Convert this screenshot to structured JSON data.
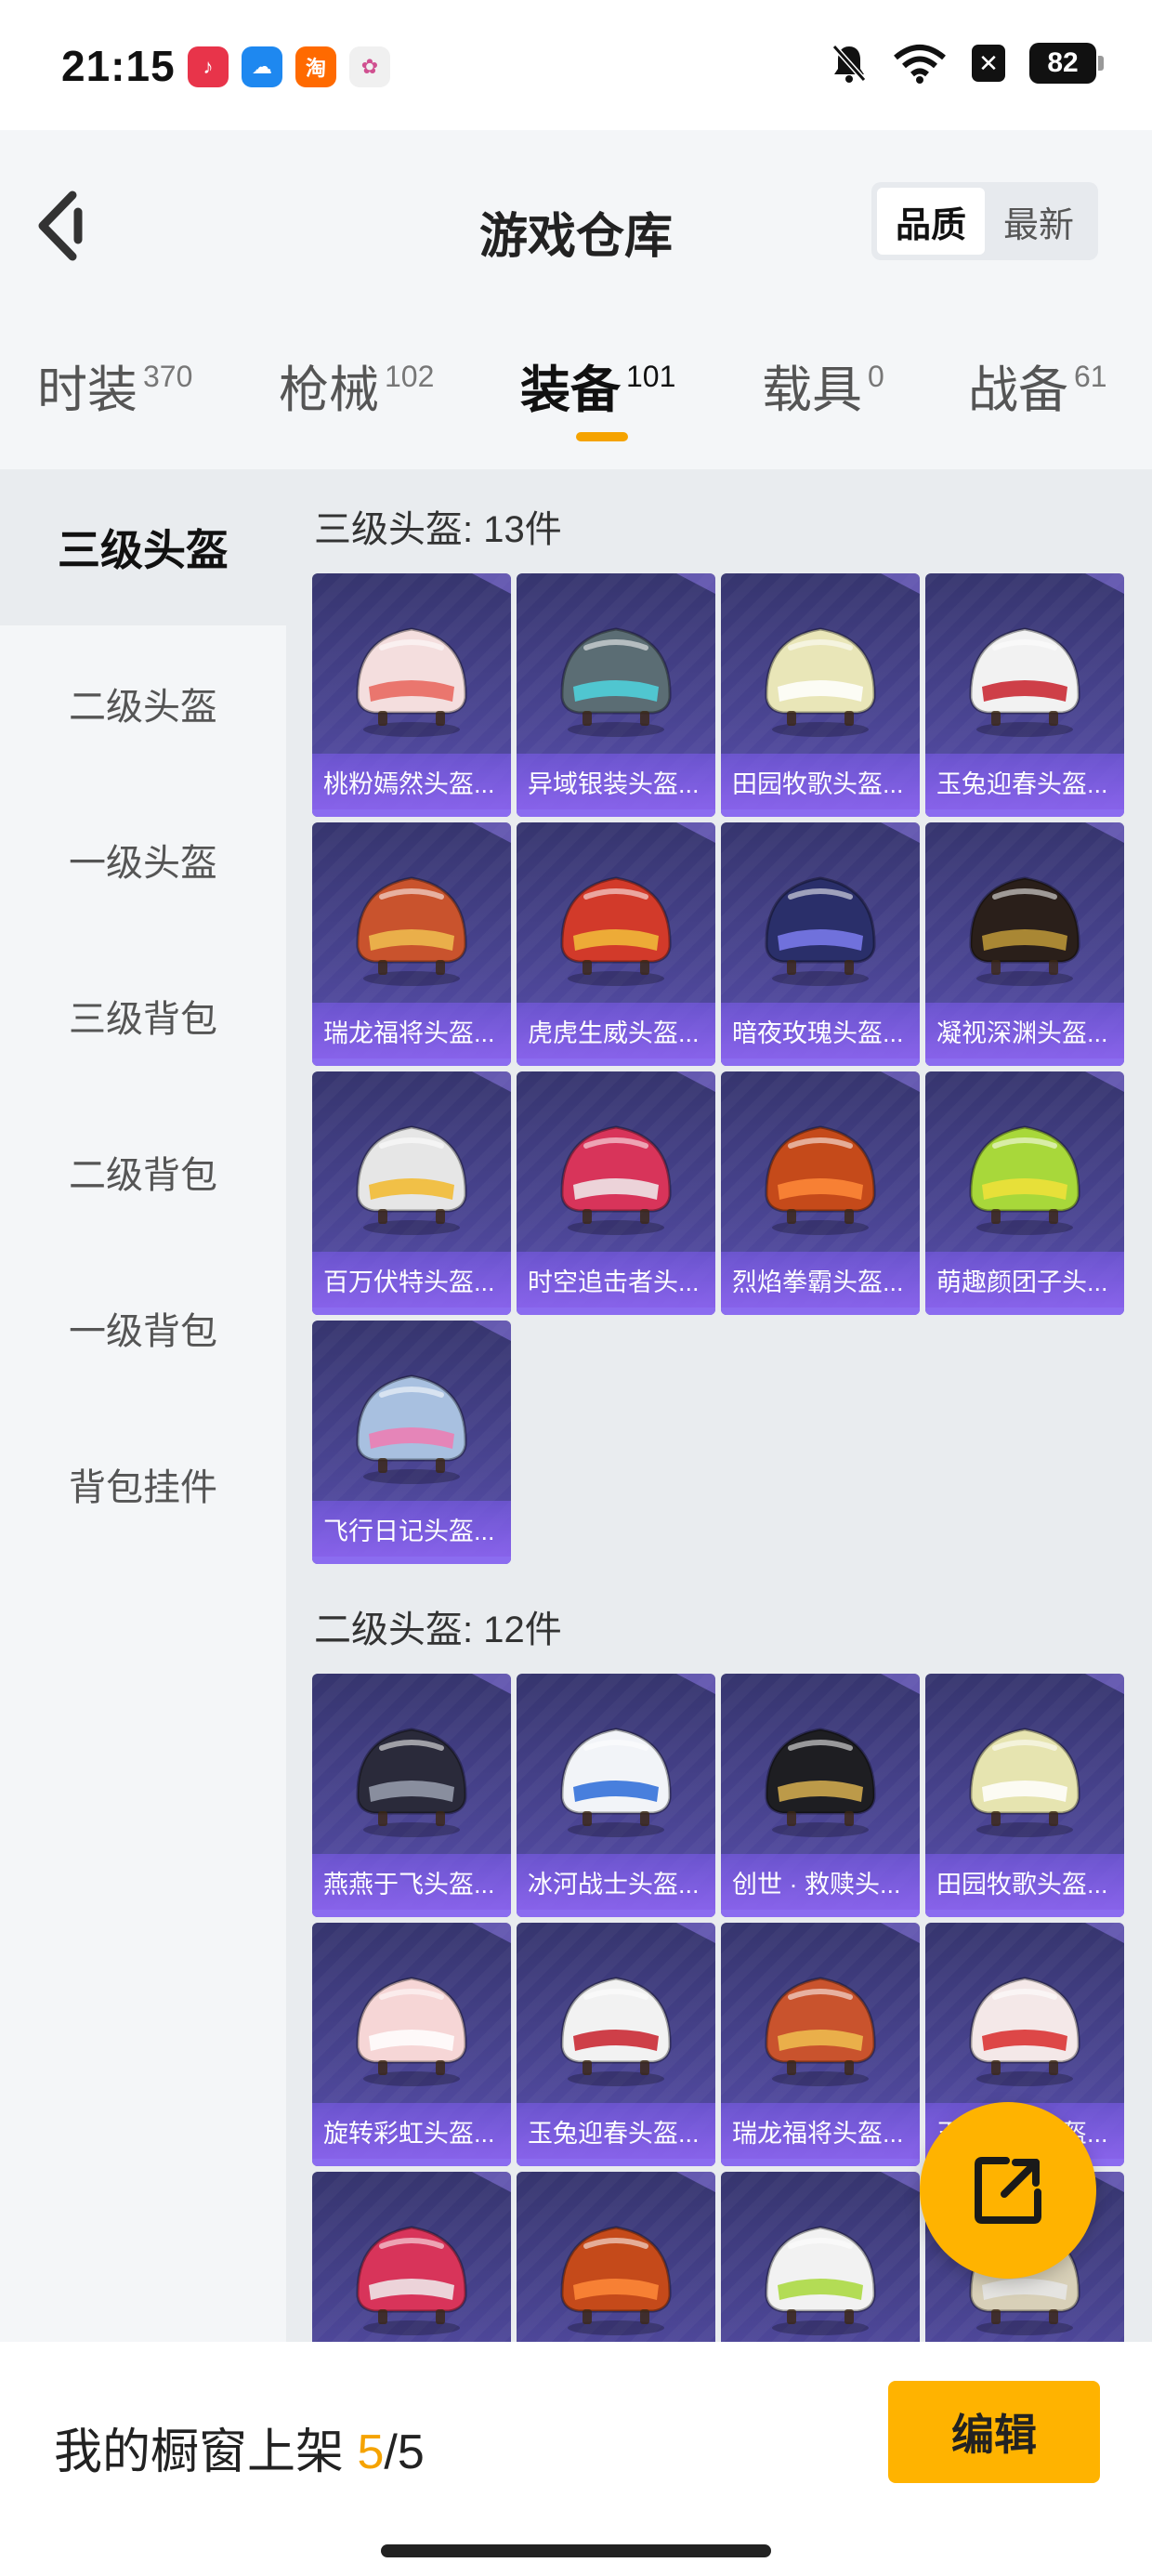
{
  "status_bar": {
    "time": "21:15",
    "battery": "82",
    "apps": [
      {
        "icon": "music-app-icon",
        "color": "#e8344a",
        "glyph": "♪"
      },
      {
        "icon": "cloud-app-icon",
        "color": "#1e88f0",
        "glyph": "☁"
      },
      {
        "icon": "taobao-app-icon",
        "color": "#ff6a00",
        "glyph": "淘"
      },
      {
        "icon": "photos-app-icon",
        "color": "#f0f0f0",
        "glyph": "✿"
      }
    ]
  },
  "header": {
    "title": "游戏仓库",
    "sort_options": [
      "品质",
      "最新"
    ]
  },
  "tabs": [
    {
      "label": "时装",
      "count": "370"
    },
    {
      "label": "枪械",
      "count": "102"
    },
    {
      "label": "装备",
      "count": "101"
    },
    {
      "label": "载具",
      "count": "0"
    },
    {
      "label": "战备",
      "count": "61"
    }
  ],
  "sidebar": {
    "items": [
      "三级头盔",
      "二级头盔",
      "一级头盔",
      "三级背包",
      "二级背包",
      "一级背包",
      "背包挂件"
    ]
  },
  "sections": [
    {
      "title": "三级头盔: 13件",
      "items": [
        {
          "name": "桃粉嫣然头盔...",
          "color": "#f4dede",
          "accent": "#e8645a"
        },
        {
          "name": "异域银装头盔...",
          "color": "#5b6d74",
          "accent": "#4fd6e0"
        },
        {
          "name": "田园牧歌头盔...",
          "color": "#e9e6b8",
          "accent": "#ffffff"
        },
        {
          "name": "玉兔迎春头盔...",
          "color": "#f2f2f2",
          "accent": "#c8202a"
        },
        {
          "name": "瑞龙福将头盔...",
          "color": "#c9532d",
          "accent": "#f0c050"
        },
        {
          "name": "虎虎生威头盔...",
          "color": "#d23a2a",
          "accent": "#f2c03a"
        },
        {
          "name": "暗夜玫瑰头盔...",
          "color": "#2a2f6a",
          "accent": "#7d7cf0"
        },
        {
          "name": "凝视深渊头盔...",
          "color": "#2a1f1a",
          "accent": "#c09a3a"
        },
        {
          "name": "百万伏特头盔...",
          "color": "#e6e6e6",
          "accent": "#f2b82a"
        },
        {
          "name": "时空追击者头...",
          "color": "#d8345a",
          "accent": "#f0f0f0"
        },
        {
          "name": "烈焰拳霸头盔...",
          "color": "#c54a1a",
          "accent": "#ff8a3a"
        },
        {
          "name": "萌趣颜团子头...",
          "color": "#a8d83a",
          "accent": "#f2e23a"
        },
        {
          "name": "飞行日记头盔...",
          "color": "#a8c0e0",
          "accent": "#f07ab0"
        }
      ]
    },
    {
      "title": "二级头盔: 12件",
      "items": [
        {
          "name": "燕燕于飞头盔...",
          "color": "#2a2a3a",
          "accent": "#9aa0b0"
        },
        {
          "name": "冰河战士头盔...",
          "color": "#f2f4f8",
          "accent": "#2a6ad8"
        },
        {
          "name": "创世 · 救赎头...",
          "color": "#1e1e22",
          "accent": "#d8b050"
        },
        {
          "name": "田园牧歌头盔...",
          "color": "#e6e4b0",
          "accent": "#ffffff"
        },
        {
          "name": "旋转彩虹头盔...",
          "color": "#f6d6d6",
          "accent": "#ffffff"
        },
        {
          "name": "玉兔迎春头盔...",
          "color": "#f2f2f2",
          "accent": "#c8202a"
        },
        {
          "name": "瑞龙福将头盔...",
          "color": "#c9532d",
          "accent": "#f0c050"
        },
        {
          "name": "玉兔迎春头盔...",
          "color": "#f4e8e8",
          "accent": "#d82a2a"
        },
        {
          "name": "",
          "color": "#d8345a",
          "accent": "#f0f0f0"
        },
        {
          "name": "",
          "color": "#c54a1a",
          "accent": "#ff8a3a"
        },
        {
          "name": "",
          "color": "#f2f2f2",
          "accent": "#a8d83a"
        },
        {
          "name": "",
          "color": "#d8d0b8",
          "accent": "#e8e8e8"
        }
      ]
    }
  ],
  "bottom_bar": {
    "showcase_prefix": "我的橱窗上架 ",
    "showcase_current": "5",
    "showcase_total": "/5",
    "edit_label": "编辑"
  },
  "colors": {
    "accent": "#f5a300",
    "button": "#ffb300",
    "card_top": "#36356e",
    "card_bottom": "#5a4fae"
  }
}
